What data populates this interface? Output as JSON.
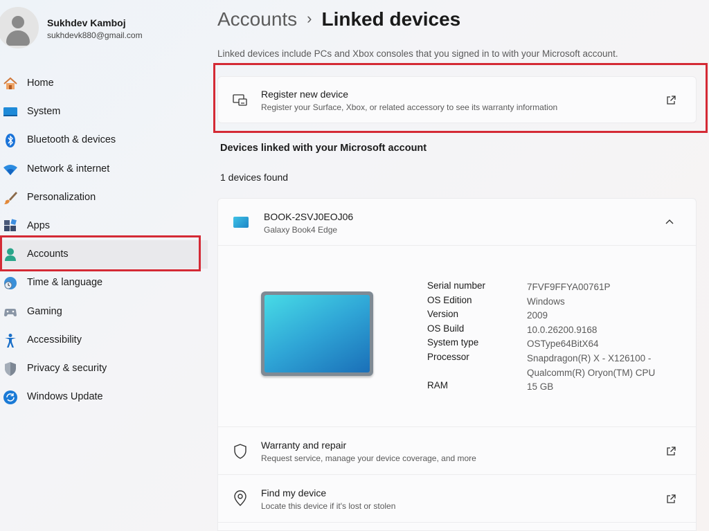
{
  "profile": {
    "name": "Sukhdev Kamboj",
    "email": "sukhdevk880@gmail.com"
  },
  "nav": {
    "items": [
      {
        "label": "Home",
        "icon": "home-icon"
      },
      {
        "label": "System",
        "icon": "system-icon"
      },
      {
        "label": "Bluetooth & devices",
        "icon": "bluetooth-icon"
      },
      {
        "label": "Network & internet",
        "icon": "wifi-icon"
      },
      {
        "label": "Personalization",
        "icon": "brush-icon"
      },
      {
        "label": "Apps",
        "icon": "apps-icon"
      },
      {
        "label": "Accounts",
        "icon": "accounts-icon",
        "selected": true
      },
      {
        "label": "Time & language",
        "icon": "clock-globe-icon"
      },
      {
        "label": "Gaming",
        "icon": "gamepad-icon"
      },
      {
        "label": "Accessibility",
        "icon": "accessibility-icon"
      },
      {
        "label": "Privacy & security",
        "icon": "shield-icon"
      },
      {
        "label": "Windows Update",
        "icon": "update-icon"
      }
    ]
  },
  "breadcrumb": {
    "parent": "Accounts",
    "separator": "›",
    "current": "Linked devices"
  },
  "intro": "Linked devices include PCs and Xbox consoles that you signed in to with your Microsoft account.",
  "register": {
    "title": "Register new device",
    "subtitle": "Register your Surface, Xbox, or related accessory to see its warranty information"
  },
  "devices_section": {
    "heading": "Devices linked with your Microsoft account",
    "found": "1 devices found"
  },
  "device": {
    "name": "BOOK-2SVJ0EOJ06",
    "model": "Galaxy Book4 Edge",
    "expanded": true,
    "specs": [
      {
        "label": "Serial number",
        "value": "7FVF9FFYA00761P"
      },
      {
        "label": "OS Edition",
        "value": "Windows"
      },
      {
        "label": "Version",
        "value": "2009"
      },
      {
        "label": "OS Build",
        "value": "10.0.26200.9168"
      },
      {
        "label": "System type",
        "value": "OSType64BitX64"
      },
      {
        "label": "Processor",
        "value": "Snapdragon(R) X - X126100 - Qualcomm(R) Oryon(TM) CPU"
      },
      {
        "label": "RAM",
        "value": "15 GB"
      }
    ]
  },
  "warranty": {
    "title": "Warranty and repair",
    "subtitle": "Request service, manage your device coverage, and more"
  },
  "find_device": {
    "title": "Find my device",
    "subtitle": "Locate this device if it's lost or stolen"
  },
  "colors": {
    "highlight_outline": "#d42a35",
    "accent": "#0067c0"
  }
}
